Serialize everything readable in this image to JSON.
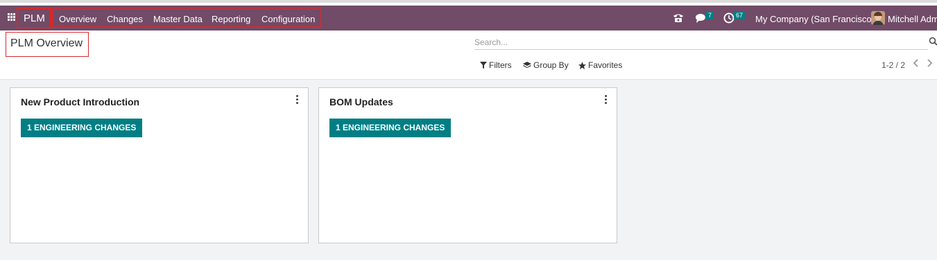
{
  "navbar": {
    "app_name": "PLM",
    "menu": [
      "Overview",
      "Changes",
      "Master Data",
      "Reporting",
      "Configuration"
    ],
    "messages_badge": "7",
    "activities_badge": "67",
    "company": "My Company (San Francisco)",
    "user": "Mitchell Admi"
  },
  "control_panel": {
    "title": "PLM Overview",
    "search_placeholder": "Search...",
    "filters_label": "Filters",
    "group_by_label": "Group By",
    "favorites_label": "Favorites",
    "pager": "1-2 / 2"
  },
  "cards": [
    {
      "title": "New Product Introduction",
      "button": "1 ENGINEERING CHANGES"
    },
    {
      "title": "BOM Updates",
      "button": "1 ENGINEERING CHANGES"
    }
  ],
  "colors": {
    "navbar": "#714b67",
    "accent": "#017e84",
    "highlight": "#d62a2a"
  }
}
